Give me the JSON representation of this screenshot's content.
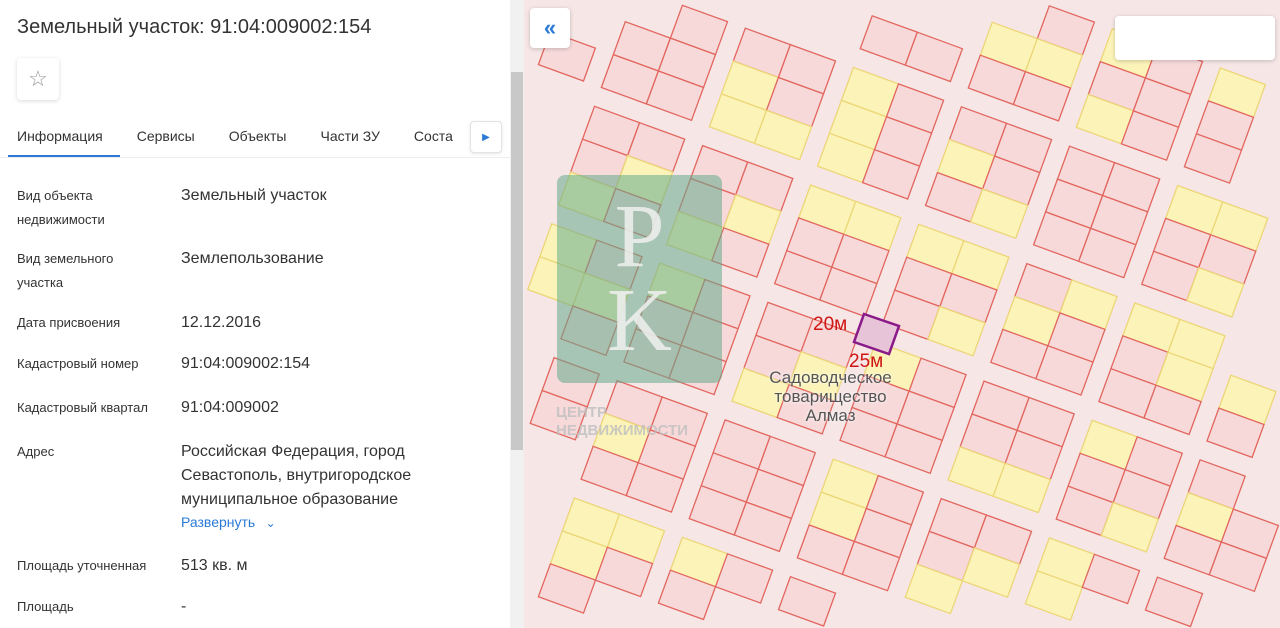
{
  "header": {
    "title": "Земельный участок: 91:04:009002:154"
  },
  "tabs": [
    "Информация",
    "Сервисы",
    "Объекты",
    "Части ЗУ",
    "Соста"
  ],
  "fields": [
    {
      "label": "Вид объекта недвижимости",
      "value": "Земельный участок"
    },
    {
      "label": "Вид земельного участка",
      "value": "Землепользование"
    },
    {
      "label": "Дата присвоения",
      "value": "12.12.2016"
    },
    {
      "label": "Кадастровый номер",
      "value": "91:04:009002:154"
    },
    {
      "label": "Кадастровый квартал",
      "value": "91:04:009002"
    },
    {
      "label": "Адрес",
      "value": "Российская Федерация, город Севастополь, внутригородское муниципальное образование"
    },
    {
      "label": "Площадь уточненная",
      "value": "513 кв. м"
    },
    {
      "label": "Площадь",
      "value": "-"
    }
  ],
  "expand_label": "Развернуть",
  "map": {
    "area_label": "Садоводческое товарищество Алмаз",
    "dim_a": "20м",
    "dim_b": "25м",
    "watermark": "ЦЕНТР НЕДВИЖИМОСТИ",
    "logo": "РК",
    "colors": {
      "parcel": "#f7d9da",
      "parcel_border": "#e2665e",
      "yellow": "#fbf3b8",
      "yellow_border": "#ecd676",
      "selected": "#8a1a8a"
    }
  },
  "icons": {
    "star": "star-icon",
    "collapse": "double-chevron-left-icon",
    "tab_next": "caret-right-icon",
    "expand": "chevron-down-icon"
  }
}
